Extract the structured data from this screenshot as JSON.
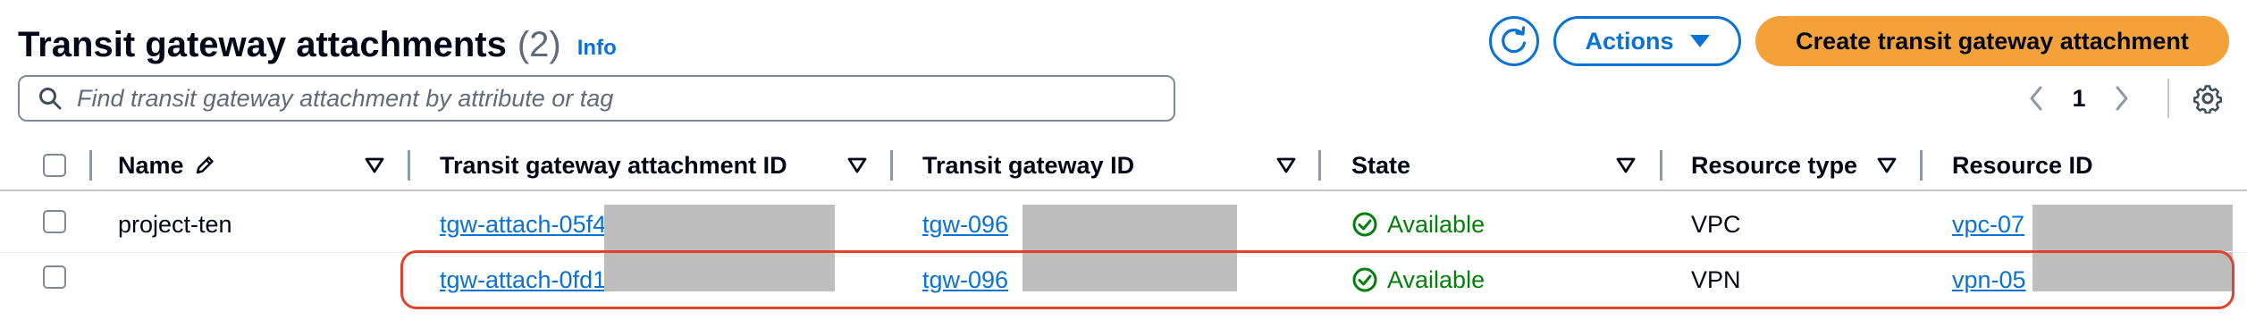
{
  "header": {
    "title": "Transit gateway attachments",
    "count": "(2)",
    "info_label": "Info"
  },
  "toolbar": {
    "refresh_icon": "refresh-icon",
    "actions_label": "Actions",
    "create_label": "Create transit gateway attachment"
  },
  "search": {
    "placeholder": "Find transit gateway attachment by attribute or tag",
    "value": ""
  },
  "pagination": {
    "current_page": "1"
  },
  "table": {
    "columns": [
      {
        "key": "name",
        "label": "Name"
      },
      {
        "key": "attachment_id",
        "label": "Transit gateway attachment ID"
      },
      {
        "key": "tgw_id",
        "label": "Transit gateway ID"
      },
      {
        "key": "state",
        "label": "State"
      },
      {
        "key": "resource_type",
        "label": "Resource type"
      },
      {
        "key": "resource_id",
        "label": "Resource ID"
      }
    ],
    "rows": [
      {
        "name": "project-ten",
        "attachment_id": "tgw-attach-05f4",
        "tgw_id": "tgw-096",
        "state": "Available",
        "resource_type": "VPC",
        "resource_id": "vpc-07"
      },
      {
        "name": "",
        "attachment_id": "tgw-attach-0fd1",
        "tgw_id": "tgw-096",
        "state": "Available",
        "resource_type": "VPN",
        "resource_id": "vpn-05"
      }
    ]
  },
  "colors": {
    "link": "#0972d3",
    "primary_button": "#f5a13a",
    "status_success": "#037f0c",
    "highlight_box": "#e0432b",
    "redaction": "#bdbdbd"
  }
}
